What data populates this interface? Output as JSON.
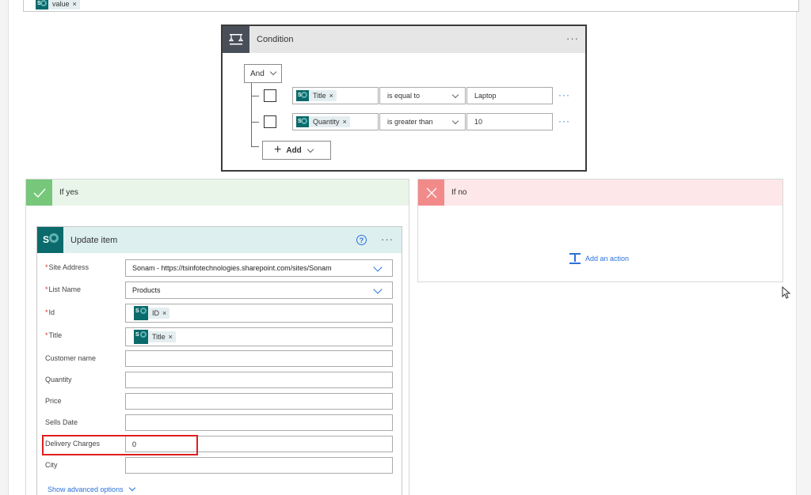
{
  "top_card": {
    "token_label": "value"
  },
  "condition": {
    "title": "Condition",
    "group_operator": "And",
    "rows": [
      {
        "operand": "Title",
        "operator": "is equal to",
        "value": "Laptop"
      },
      {
        "operand": "Quantity",
        "operator": "is greater than",
        "value": "10"
      }
    ],
    "add_label": "Add"
  },
  "branch_yes": {
    "label": "If yes"
  },
  "branch_no": {
    "label": "If no",
    "add_action_label": "Add an action"
  },
  "update_item": {
    "title": "Update item",
    "help_glyph": "?",
    "fields": {
      "site_address": {
        "label": "Site Address",
        "value": "Sonam - https://tsinfotechnologies.sharepoint.com/sites/Sonam"
      },
      "list_name": {
        "label": "List Name",
        "value": "Products"
      },
      "id": {
        "label": "Id",
        "token": "ID"
      },
      "title": {
        "label": "Title",
        "token": "Title"
      },
      "customer_name": {
        "label": "Customer name",
        "value": ""
      },
      "quantity": {
        "label": "Quantity",
        "value": ""
      },
      "price": {
        "label": "Price",
        "value": ""
      },
      "sells_date": {
        "label": "Sells Date",
        "value": ""
      },
      "delivery_charges": {
        "label": "Delivery Charges",
        "value": "0"
      },
      "city": {
        "label": "City",
        "value": ""
      }
    },
    "advanced_link": "Show advanced options"
  },
  "colors": {
    "accent_blue": "#2b72d9",
    "sharepoint_teal": "#0b6a6b",
    "yes_green": "#77c77a",
    "no_red": "#f28a8a",
    "highlight_red": "#e01e1e"
  }
}
